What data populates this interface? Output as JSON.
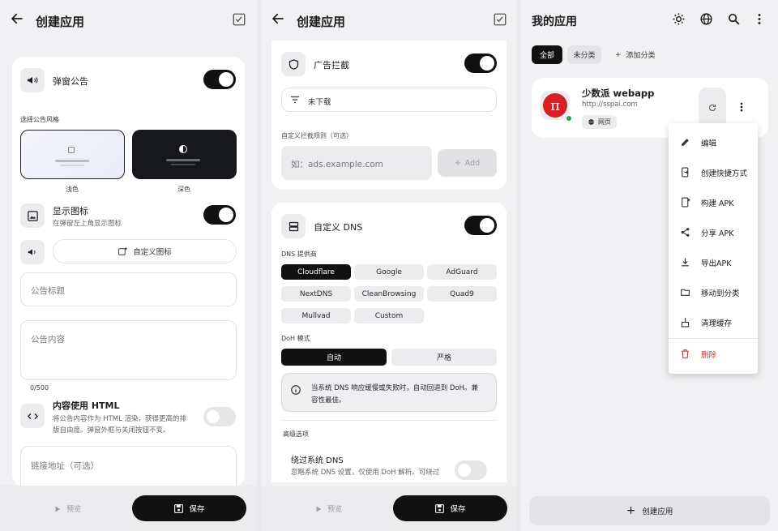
{
  "screen1": {
    "title": "创建应用",
    "popup_label": "弹窗公告",
    "style_label": "选择公告风格",
    "style_light": "浅色",
    "style_dark": "深色",
    "show_icon_label": "显示图标",
    "show_icon_sub": "在弹窗左上角显示图标",
    "custom_icon_button": "自定义图标",
    "announce_title_placeholder": "公告标题",
    "announce_content_placeholder": "公告内容",
    "char_count": "0/500",
    "html_label": "内容使用 HTML",
    "html_sub_1": "将公告内容作为 HTML 渲染，获得更高的排",
    "html_sub_2": "版自由度。弹窗外框与关闭按钮不变。",
    "link_placeholder": "链接地址（可选）",
    "preview_label": "预览",
    "save_label": "保存"
  },
  "screen2": {
    "title": "创建应用",
    "adblock_label": "广告拦截",
    "not_downloaded": "未下载",
    "custom_rules_label": "自定义拦截规则（可选）",
    "rule_placeholder": "如：ads.example.com",
    "add_label": "Add",
    "dns_label": "自定义 DNS",
    "dns_provider_label": "DNS 提供商",
    "providers": [
      "Cloudflare",
      "Google",
      "AdGuard",
      "NextDNS",
      "CleanBrowsing",
      "Quad9",
      "Mullvad",
      "Custom"
    ],
    "selected_provider": "Cloudflare",
    "doh_label": "DoH 模式",
    "doh_auto": "自动",
    "doh_strict": "严格",
    "info_line_1": "当系统 DNS 响应缓慢或失败时，自动回退到 DoH。兼",
    "info_line_2": "容性最佳。",
    "advanced_label": "高级选项",
    "bypass_label": "绕过系统 DNS",
    "bypass_sub": "忽略系统 DNS 设置，仅使用 DoH 解析。可绕过",
    "preview_label": "预览",
    "save_label": "保存"
  },
  "screen3": {
    "title": "我的应用",
    "tab_all": "全部",
    "tab_uncategorized": "未分类",
    "add_category": "添加分类",
    "app_name": "少数派 webapp",
    "app_url": "http://sspai.com",
    "app_badge": "网页",
    "menu": [
      "编辑",
      "创建快捷方式",
      "构建 APK",
      "分享 APK",
      "导出APK",
      "移动到分类",
      "清理缓存",
      "删除"
    ],
    "create_app_label": "创建应用",
    "colors": {
      "accent_dark": "#111111",
      "app_icon_red": "#d61f26",
      "delete_red": "#c0392b",
      "status_green": "#2e9e4f"
    }
  }
}
